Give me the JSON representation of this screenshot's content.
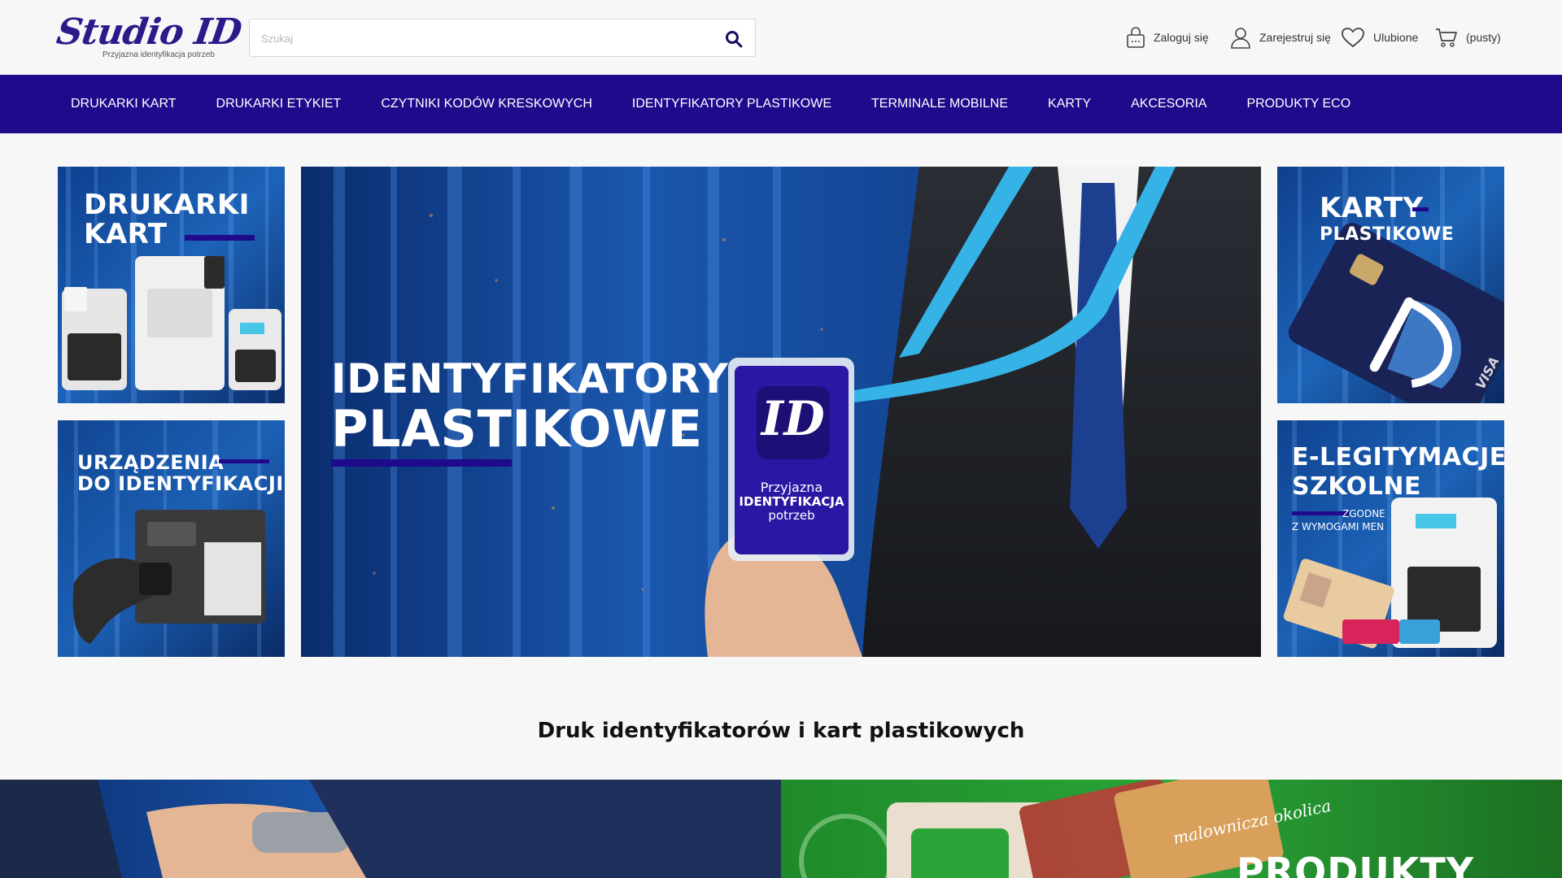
{
  "header": {
    "logo_text": "Studio ID",
    "logo_tagline": "Przyjazna identyfikacja potrzeb",
    "search_placeholder": "Szukaj",
    "login_label": "Zaloguj się",
    "register_label": "Zarejestruj się",
    "favorites_label": "Ulubione",
    "cart_label": "(pusty)"
  },
  "nav": {
    "items": [
      "DRUKARKI KART",
      "DRUKARKI ETYKIET",
      "CZYTNIKI KODÓW KRESKOWYCH",
      "IDENTYFIKATORY PLASTIKOWE",
      "TERMINALE MOBILNE",
      "KARTY",
      "AKCESORIA",
      "PRODUKTY ECO"
    ]
  },
  "banners": {
    "top_left": {
      "line1": "DRUKARKI",
      "line2": "KART"
    },
    "bottom_left": {
      "line1": "URZĄDZENIA",
      "line2": "DO IDENTYFIKACJI"
    },
    "center": {
      "line1": "IDENTYFIKATORY",
      "line2": "PLASTIKOWE",
      "badge_logo": "ID",
      "badge_l1": "Przyjazna",
      "badge_l2": "IDENTYFIKACJA",
      "badge_l3": "potrzeb"
    },
    "top_right": {
      "line1": "KARTY",
      "line2": "PLASTIKOWE",
      "card_brand": "VISA"
    },
    "bottom_right": {
      "line1": "E-LEGITYMACJE",
      "line2": "SZKOLNE",
      "sub1": "ZGODNE",
      "sub2": "Z WYMOGAMI MEN"
    }
  },
  "section": {
    "title": "Druk identyfikatorów i kart plastikowych"
  },
  "bottom_banners": {
    "right_text": "PRODUKTY",
    "right_card_text": "malownicza okolica"
  },
  "colors": {
    "brand": "#1f0a8c",
    "accent_blue": "#1e5fb0",
    "lanyard": "#35b3e6"
  }
}
